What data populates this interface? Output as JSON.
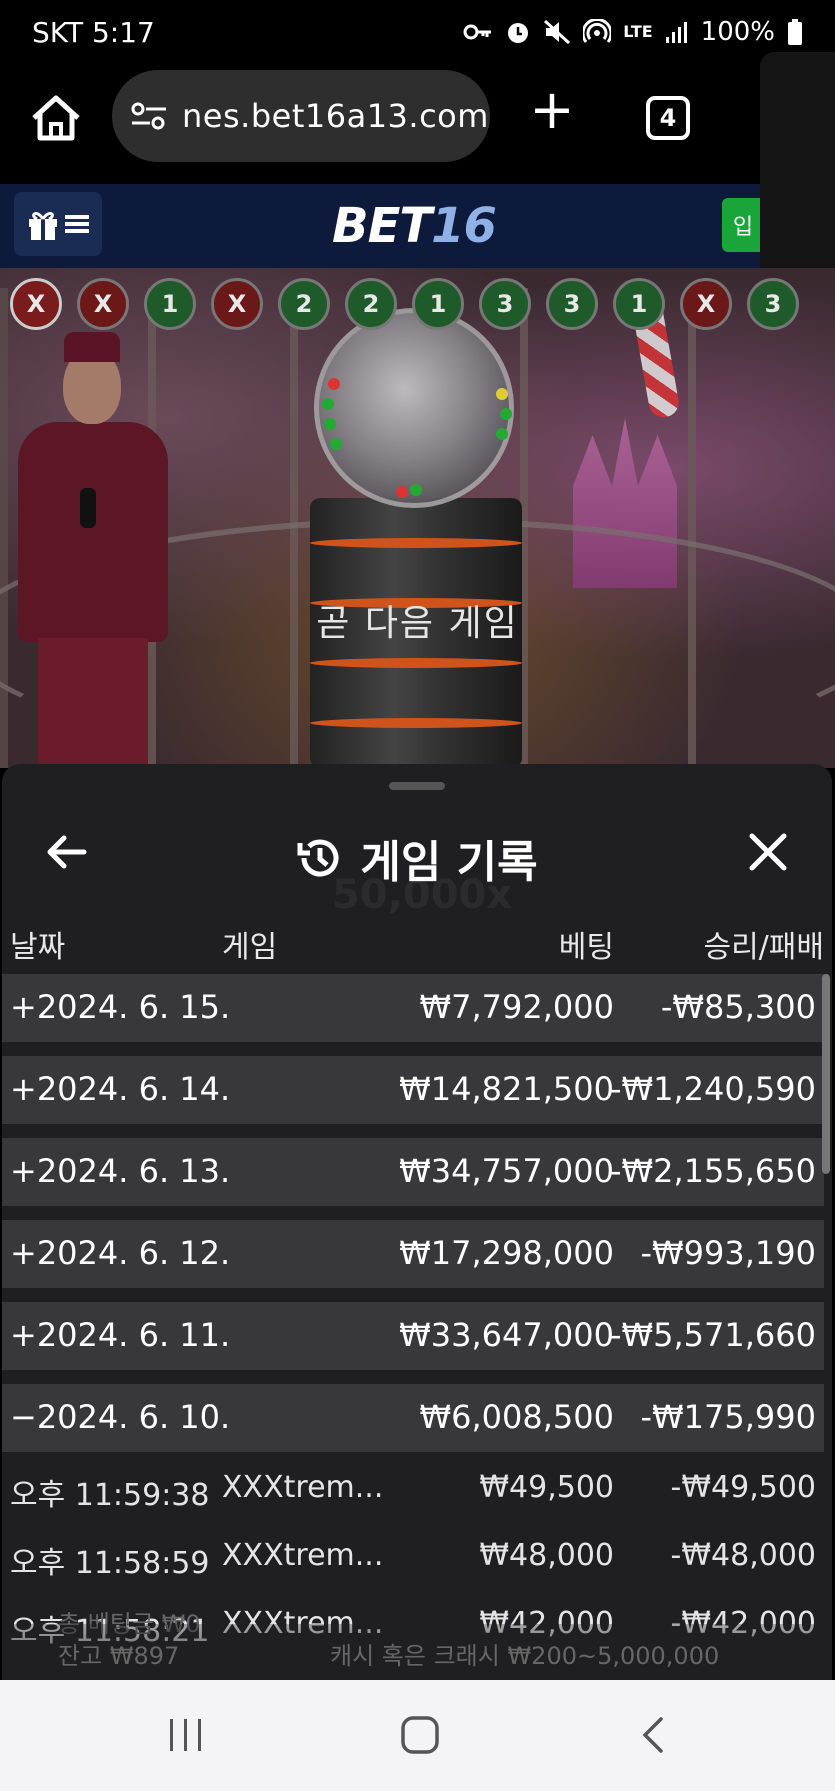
{
  "status_bar": {
    "carrier_time": "SKT 5:17",
    "network": "LTE",
    "battery": "100%",
    "icons": [
      "key-icon",
      "alarm-icon",
      "mute-icon",
      "hotspot-icon",
      "lte-icon",
      "signal-icon",
      "battery-icon"
    ]
  },
  "browser": {
    "url": "nes.bet16a13.com",
    "tab_count": "4"
  },
  "site": {
    "logo_part1": "BET",
    "logo_part2": "16",
    "login_label": "입",
    "brand_color": "#0d1a3b",
    "login_color": "#1aa53a"
  },
  "game": {
    "message": "곧 다음 게임",
    "results": [
      "X",
      "X",
      "1",
      "X",
      "2",
      "2",
      "1",
      "3",
      "3",
      "1",
      "X",
      "3"
    ]
  },
  "history": {
    "title": "게임 기록",
    "columns": {
      "date": "날짜",
      "game": "게임",
      "bet": "베팅",
      "win_loss": "승리/패배"
    },
    "days": [
      {
        "date": "+2024. 6. 15.",
        "bet": "₩7,792,000",
        "result": "-₩85,300"
      },
      {
        "date": "+2024. 6. 14.",
        "bet": "₩14,821,500",
        "result": "-₩1,240,590"
      },
      {
        "date": "+2024. 6. 13.",
        "bet": "₩34,757,000",
        "result": "-₩2,155,650"
      },
      {
        "date": "+2024. 6. 12.",
        "bet": "₩17,298,000",
        "result": "-₩993,190"
      },
      {
        "date": "+2024. 6. 11.",
        "bet": "₩33,647,000",
        "result": "-₩5,571,660"
      },
      {
        "date": "−2024. 6. 10.",
        "bet": "₩6,008,500",
        "result": "-₩175,990"
      }
    ],
    "entries": [
      {
        "time": "오후 11:59:38",
        "game": "XXXtrem...",
        "bet": "₩49,500",
        "result": "-₩49,500"
      },
      {
        "time": "오후 11:58:59",
        "game": "XXXtrem...",
        "bet": "₩48,000",
        "result": "-₩48,000"
      },
      {
        "time": "오후 11:58:21",
        "game": "XXXtrem...",
        "bet": "₩42,000",
        "result": "-₩42,000"
      }
    ],
    "background_text": {
      "multiplier": "50,000x",
      "total_bet": "총 베팅금 ₩0",
      "balance": "잔고 ₩897",
      "cashout_range": "캐시 혹은 크래시 ₩200~5,000,000"
    }
  }
}
